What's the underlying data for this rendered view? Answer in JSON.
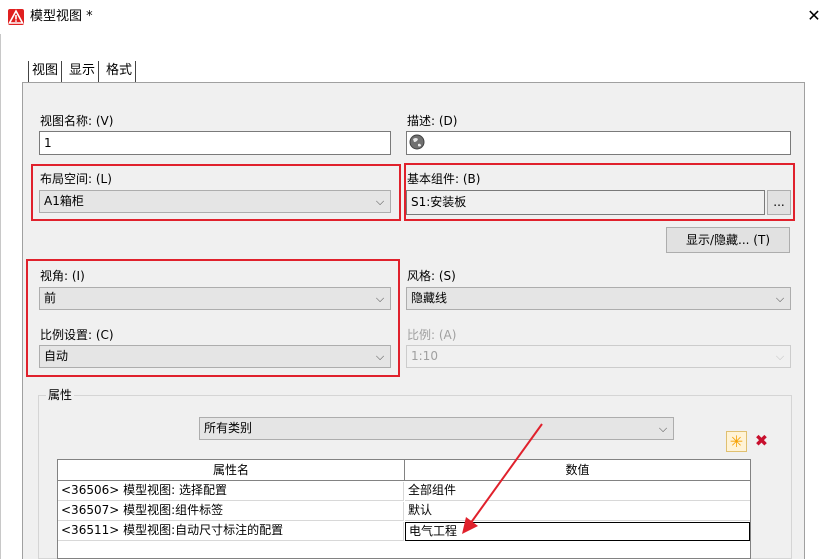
{
  "window": {
    "title": "模型视图 *",
    "close_glyph": "✕",
    "icon": "warning-app-icon"
  },
  "tabs": [
    {
      "label": "视图",
      "active": true
    },
    {
      "label": "显示",
      "active": false
    },
    {
      "label": "格式",
      "active": false
    }
  ],
  "fields": {
    "view_name": {
      "label": "视图名称: (V)",
      "value": "1"
    },
    "description": {
      "label": "描述: (D)",
      "value": ""
    },
    "layout_space": {
      "label": "布局空间: (L)",
      "value": "A1箱柜"
    },
    "base_component": {
      "label": "基本组件: (B)",
      "value": "S1:安装板",
      "browse_label": "..."
    },
    "show_hide_button": "显示/隐藏... (T)",
    "view_angle": {
      "label": "视角: (I)",
      "value": "前"
    },
    "style": {
      "label": "风格: (S)",
      "value": "隐藏线"
    },
    "scale_setting": {
      "label": "比例设置: (C)",
      "value": "自动"
    },
    "scale": {
      "label": "比例: (A)",
      "value": "1:10"
    }
  },
  "properties": {
    "group_label": "属性",
    "category": "所有类别",
    "columns": [
      "属性名",
      "数值"
    ],
    "rows": [
      {
        "name": "<36506> 模型视图: 选择配置",
        "value": "全部组件"
      },
      {
        "name": "<36507> 模型视图:组件标签",
        "value": "默认"
      },
      {
        "name": "<36511> 模型视图:自动尺寸标注的配置",
        "value": "电气工程"
      }
    ]
  },
  "colors": {
    "highlight": "#e0212c",
    "panel": "#f0f0f0",
    "accent_icon": "#f5a000",
    "delete_icon": "#c8102e"
  }
}
